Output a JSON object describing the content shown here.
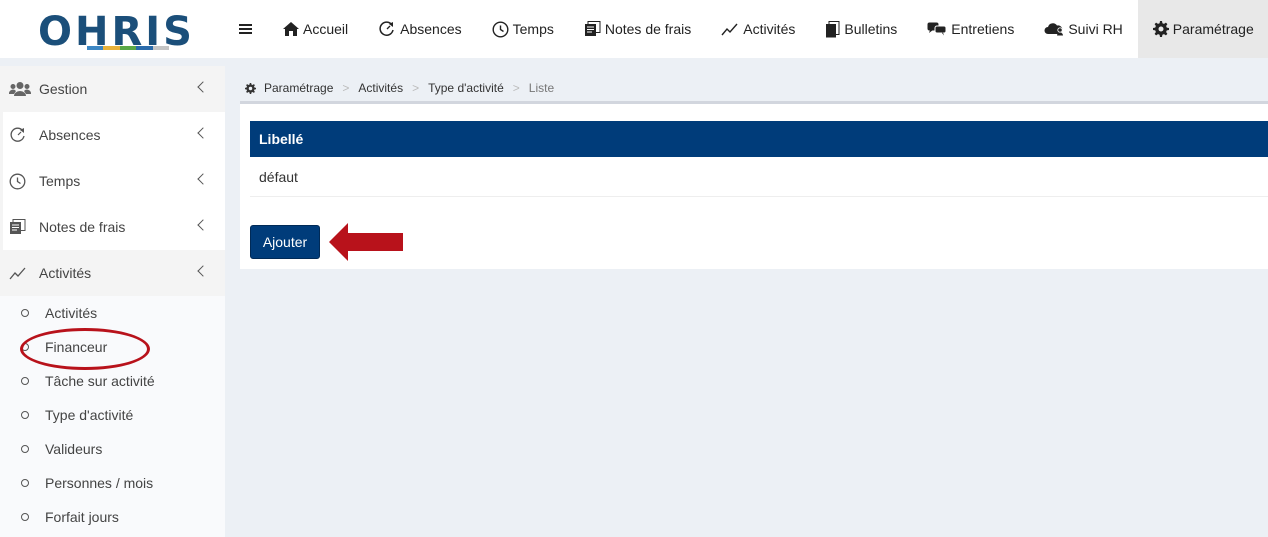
{
  "brand": {
    "logo_text": "OHRIS",
    "bar_colors": [
      "#3d87c4",
      "#e8b23a",
      "#5aa846",
      "#2a6bab",
      "#c4c4c4"
    ]
  },
  "colors": {
    "primary": "#003c7a",
    "annotation": "#b8121b"
  },
  "topnav": {
    "menu_icon": "hamburger-icon",
    "items": [
      {
        "label": "Accueil",
        "icon": "home-icon"
      },
      {
        "label": "Absences",
        "icon": "refresh-icon"
      },
      {
        "label": "Temps",
        "icon": "clock-icon"
      },
      {
        "label": "Notes de frais",
        "icon": "receipt-icon"
      },
      {
        "label": "Activités",
        "icon": "chart-line-icon"
      },
      {
        "label": "Bulletins",
        "icon": "document-icon"
      },
      {
        "label": "Entretiens",
        "icon": "chat-icon"
      },
      {
        "label": "Suivi RH",
        "icon": "cloud-user-icon"
      },
      {
        "label": "Paramétrage",
        "icon": "gear-icon",
        "active": true
      }
    ]
  },
  "sidebar": {
    "items": [
      {
        "label": "Gestion",
        "icon": "users-icon"
      },
      {
        "label": "Absences",
        "icon": "refresh-icon"
      },
      {
        "label": "Temps",
        "icon": "clock-icon"
      },
      {
        "label": "Notes de frais",
        "icon": "receipt-icon"
      },
      {
        "label": "Activités",
        "icon": "chart-line-icon",
        "expanded": true
      }
    ],
    "submenu": [
      "Activités",
      "Financeur",
      "Tâche sur activité",
      "Type d'activité",
      "Valideurs",
      "Personnes / mois",
      "Forfait jours"
    ]
  },
  "breadcrumb": [
    "Paramétrage",
    "Activités",
    "Type d'activité",
    "Liste"
  ],
  "table": {
    "header": "Libellé",
    "rows": [
      "défaut"
    ]
  },
  "add_button": "Ajouter"
}
